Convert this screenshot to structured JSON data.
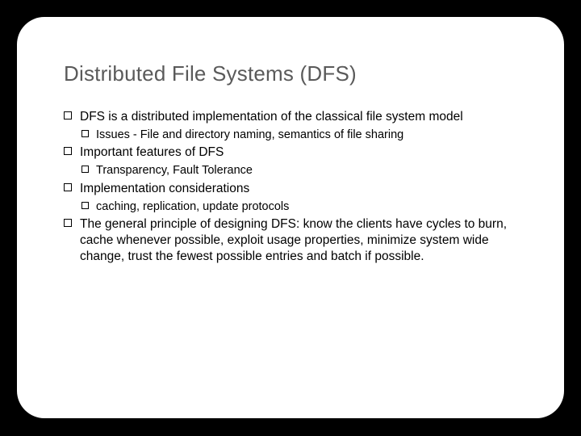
{
  "title": "Distributed File Systems (DFS)",
  "bullets": {
    "b1": "DFS is a distributed implementation of the classical file system model",
    "s1": "Issues - File and directory naming, semantics of file sharing",
    "b2": "Important features of DFS",
    "s2": "Transparency, Fault Tolerance",
    "b3": "Implementation considerations",
    "s3": "caching, replication, update protocols",
    "b4": "The general principle of designing DFS: know the clients have cycles to burn, cache whenever possible, exploit usage properties, minimize system wide change, trust the fewest possible entries and batch if possible."
  }
}
